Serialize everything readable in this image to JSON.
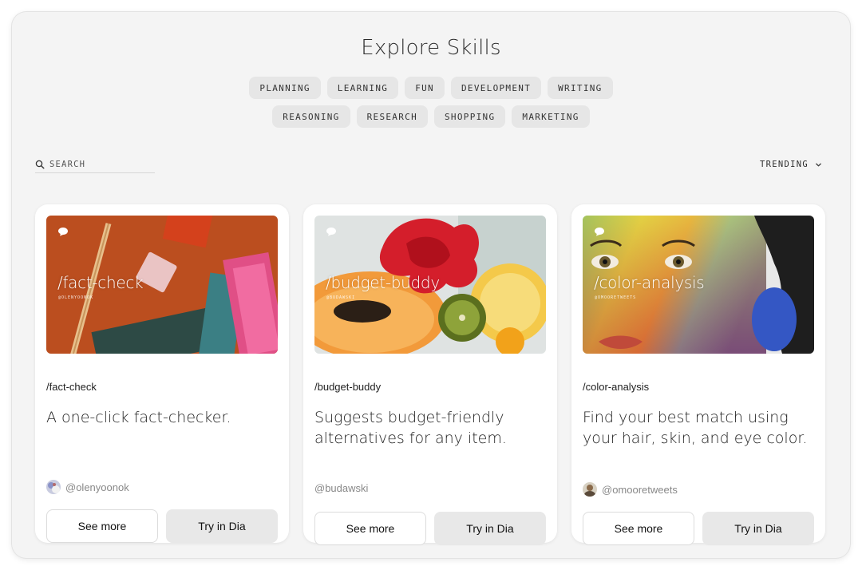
{
  "page": {
    "title": "Explore Skills"
  },
  "tags": {
    "row1": [
      "PLANNING",
      "LEARNING",
      "FUN",
      "DEVELOPMENT",
      "WRITING"
    ],
    "row2": [
      "REASONING",
      "RESEARCH",
      "SHOPPING",
      "MARKETING"
    ]
  },
  "search": {
    "placeholder": "SEARCH",
    "icon": "search-icon"
  },
  "sort": {
    "label": "TRENDING",
    "icon": "chevron-down-icon"
  },
  "cards": [
    {
      "overlay_title": "/fact-check",
      "overlay_handle": "@OLENYOONOK",
      "slug": "/fact-check",
      "description": "A one-click fact-checker.",
      "author": "@olenyoonok",
      "see_more": "See more",
      "try": "Try in Dia"
    },
    {
      "overlay_title": "/budget-buddy",
      "overlay_handle": "@BUDAWSKI",
      "slug": "/budget-buddy",
      "description": "Suggests budget-friendly alternatives for any item.",
      "author": "@budawski",
      "see_more": "See more",
      "try": "Try in Dia"
    },
    {
      "overlay_title": "/color-analysis",
      "overlay_handle": "@OMOORETWEETS",
      "slug": "/color-analysis",
      "description": "Find your best match using your hair, skin, and eye color.",
      "author": "@omooretweets",
      "see_more": "See more",
      "try": "Try in Dia"
    }
  ],
  "colors": {
    "window_bg": "#f4f4f4",
    "tag_bg": "#e6e6e6",
    "try_button_bg": "#e8e8e8",
    "card_bg": "#ffffff"
  }
}
